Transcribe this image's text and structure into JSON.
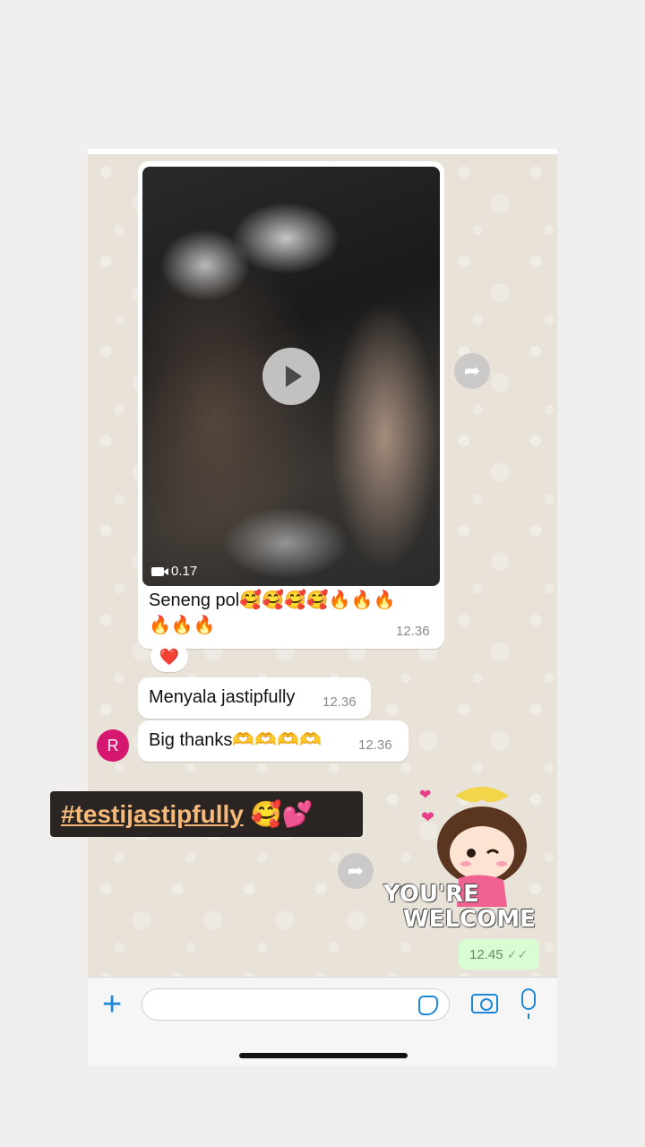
{
  "messages": {
    "video": {
      "duration": "0.17",
      "caption_line1": "Seneng pol🥰🥰🥰🥰🔥🔥🔥",
      "caption_line2": "🔥🔥🔥",
      "time": "12.36",
      "reaction": "❤️"
    },
    "msg2": {
      "text": "Menyala jastipfully",
      "time": "12.36"
    },
    "msg3": {
      "text": "Big thanks🫶🫶🫶🫶",
      "time": "12.36"
    },
    "sender_initial": "R",
    "sticker": {
      "line1": "YOU'RE",
      "line2": "WELCOME"
    },
    "outgoing_time": "12.45"
  },
  "overlay": {
    "hashtag": "#testijastipfully",
    "emoji": "🥰💕"
  },
  "icons": {
    "forward": "forward-arrow-icon",
    "play": "play-icon",
    "video": "video-camera-icon",
    "plus": "plus-icon",
    "sticker": "sticker-icon",
    "camera": "camera-icon",
    "mic": "microphone-icon",
    "read": "double-check-icon"
  },
  "colors": {
    "accent": "#1e88d6",
    "outgoing_bubble": "#d9fdd3",
    "avatar": "#d6176f",
    "hashtag_text": "#f6b97a",
    "hashtag_bg": "#2a2522"
  }
}
